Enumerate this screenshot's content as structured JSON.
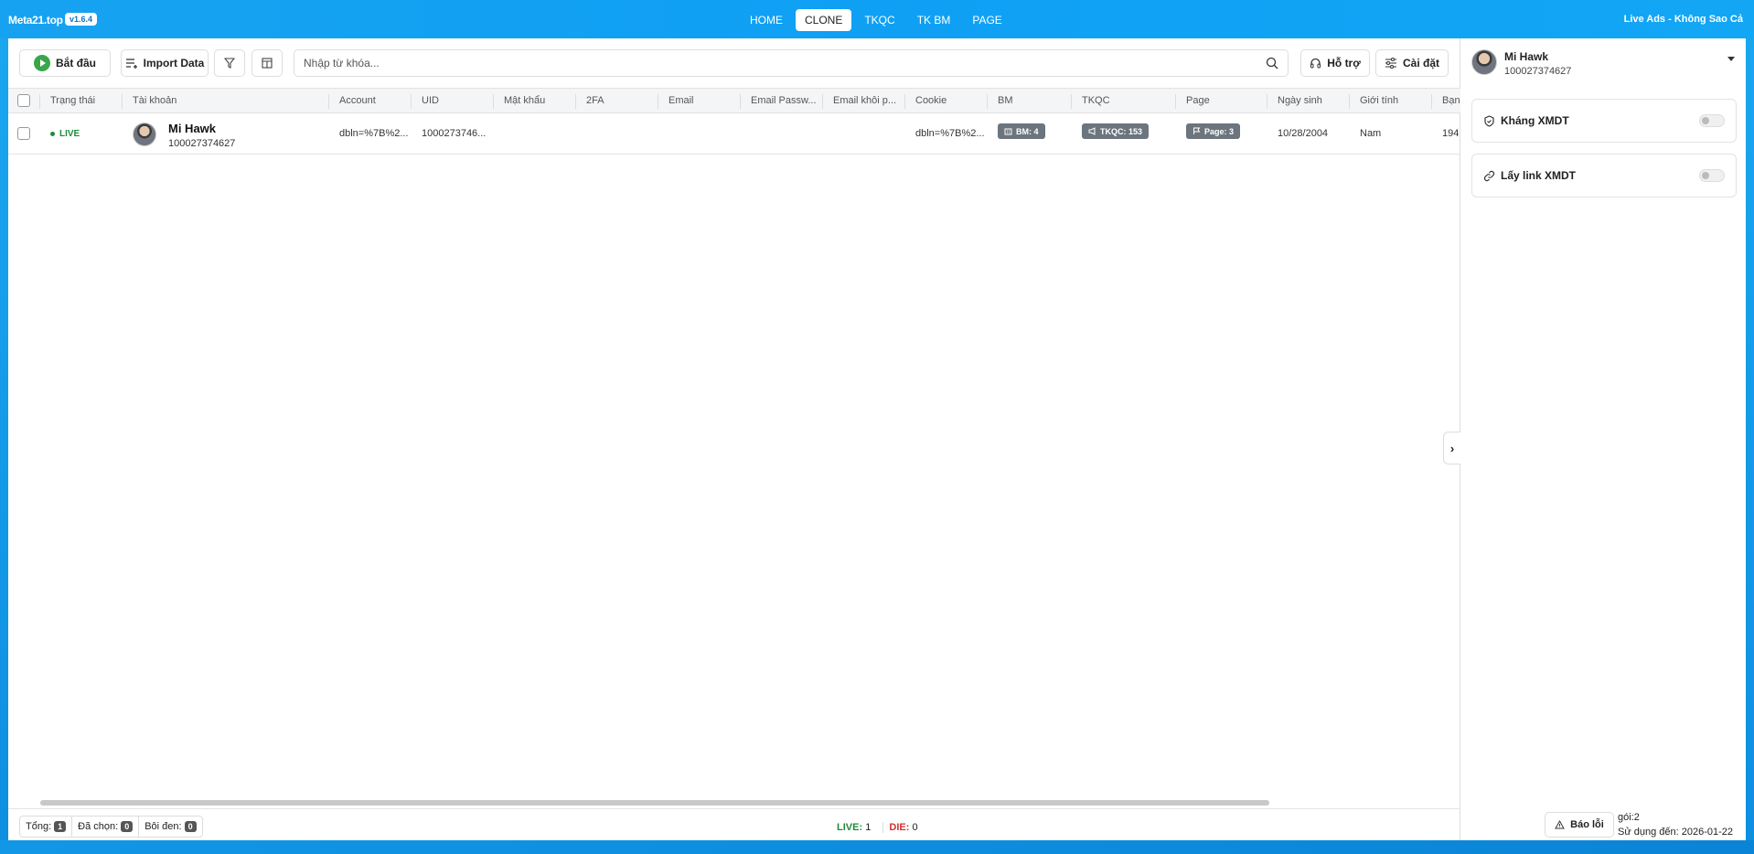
{
  "header": {
    "brand": "Meta21.top",
    "version": "v1.6.4",
    "tabs": [
      "HOME",
      "CLONE",
      "TKQC",
      "TK BM",
      "PAGE"
    ],
    "active_tab": "CLONE",
    "right_text": "Live Ads - Không Sao Cả"
  },
  "toolbar": {
    "start_label": "Bắt đầu",
    "import_label": "Import Data",
    "search_placeholder": "Nhập từ khóa...",
    "support_label": "Hỗ trợ",
    "settings_label": "Cài đặt"
  },
  "table": {
    "columns": [
      "Trạng thái",
      "Tài khoản",
      "Account",
      "UID",
      "Mật khẩu",
      "2FA",
      "Email",
      "Email Passw...",
      "Email khôi p...",
      "Cookie",
      "BM",
      "TKQC",
      "Page",
      "Ngày sinh",
      "Giới tính",
      "Bạn"
    ],
    "rows": [
      {
        "status": "LIVE",
        "name": "Mi Hawk",
        "id": "100027374627",
        "account": "dbln=%7B%2...",
        "uid": "1000273746...",
        "password": "",
        "twofa": "",
        "email": "",
        "email_password": "",
        "email_recovery": "",
        "cookie": "dbln=%7B%2...",
        "bm": "BM: 4",
        "tkqc": "TKQC: 153",
        "page": "Page: 3",
        "birthday": "10/28/2004",
        "gender": "Nam",
        "friends": "194"
      }
    ]
  },
  "footer": {
    "total_label": "Tổng:",
    "total": "1",
    "selected_label": "Đã chọn:",
    "selected": "0",
    "highlighted_label": "Bôi đen:",
    "highlighted": "0",
    "live_label": "LIVE:",
    "live": "1",
    "die_label": "DIE:",
    "die": "0"
  },
  "right_panel": {
    "user_name": "Mi Hawk",
    "user_id": "100027374627",
    "options": [
      {
        "label": "Kháng XMDT",
        "enabled": false
      },
      {
        "label": "Lấy link XMDT",
        "enabled": false
      }
    ],
    "report_label": "Báo lỗi",
    "plan": "gói:2",
    "expiry": "Sử dụng đến: 2026-01-22"
  },
  "colors": {
    "accent": "#0fa0f4",
    "live": "#1e8a3c",
    "die": "#d63030",
    "pill": "#6c757d"
  }
}
